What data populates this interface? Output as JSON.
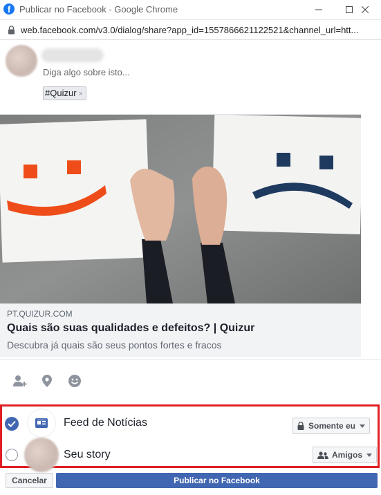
{
  "window": {
    "title": "Publicar no Facebook - Google Chrome",
    "logo_letter": "f"
  },
  "address_bar": {
    "url": "web.facebook.com/v3.0/dialog/share?app_id=1557866621122521&channel_url=htt..."
  },
  "composer": {
    "placeholder": "Diga algo sobre isto...",
    "hashtag": "#Quizur",
    "hashtag_remove": "×"
  },
  "link_preview": {
    "domain": "PT.QUIZUR.COM",
    "title": "Quais são suas qualidades e defeitos? | Quizur",
    "description": "Descubra já quais são seus pontos fortes e fracos"
  },
  "toolbar": {
    "icons": [
      "tag-friends-icon",
      "location-icon",
      "feeling-icon"
    ]
  },
  "destinations": {
    "feed": {
      "label": "Feed de Notícias",
      "checked": true,
      "privacy": "Somente eu"
    },
    "story": {
      "label": "Seu story",
      "checked": false,
      "privacy": "Amigos"
    }
  },
  "actions": {
    "cancel": "Cancelar",
    "publish": "Publicar no Facebook"
  },
  "colors": {
    "facebook_blue": "#4267b2",
    "highlight_red": "#e01e24",
    "orange_smile": "#ee4d1a",
    "navy_frown": "#1f3a5f"
  }
}
